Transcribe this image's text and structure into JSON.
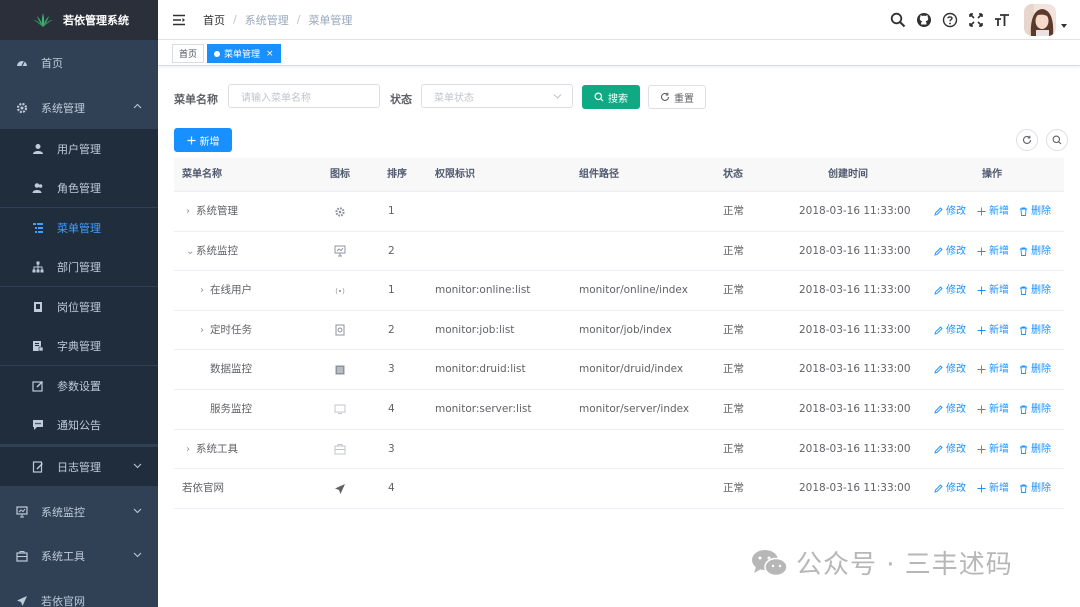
{
  "sidebar": {
    "logo_text": "若依管理系统",
    "items": [
      {
        "label": "首页",
        "icon": "dashboard-icon"
      },
      {
        "label": "系统管理",
        "icon": "gear-icon"
      },
      {
        "label": "用户管理",
        "icon": "user-icon"
      },
      {
        "label": "角色管理",
        "icon": "peoples-icon"
      },
      {
        "label": "菜单管理",
        "icon": "tree-table-icon"
      },
      {
        "label": "部门管理",
        "icon": "tree-icon"
      },
      {
        "label": "岗位管理",
        "icon": "post-icon"
      },
      {
        "label": "字典管理",
        "icon": "dict-icon"
      },
      {
        "label": "参数设置",
        "icon": "edit-icon"
      },
      {
        "label": "通知公告",
        "icon": "message-icon"
      },
      {
        "label": "日志管理",
        "icon": "log-icon"
      },
      {
        "label": "系统监控",
        "icon": "monitor-icon"
      },
      {
        "label": "系统工具",
        "icon": "tool-icon"
      },
      {
        "label": "若依官网",
        "icon": "guide-icon"
      }
    ]
  },
  "navbar": {
    "breadcrumb": [
      "首页",
      "系统管理",
      "菜单管理"
    ],
    "separator": "/"
  },
  "tags": {
    "home": "首页",
    "active": "菜单管理",
    "close": "×"
  },
  "search": {
    "name_label": "菜单名称",
    "name_placeholder": "请输入菜单名称",
    "status_label": "状态",
    "status_placeholder": "菜单状态",
    "search_button": "搜索",
    "reset_button": "重置"
  },
  "toolbar": {
    "add_button": "新增"
  },
  "table": {
    "headers": [
      "菜单名称",
      "图标",
      "排序",
      "权限标识",
      "组件路径",
      "状态",
      "创建时间",
      "操作"
    ],
    "rows": [
      {
        "name": "系统管理",
        "indent": 0,
        "expander": "›",
        "icon": "gear-icon",
        "order": "1",
        "perms": "",
        "component": "",
        "status": "正常",
        "created": "2018-03-16 11:33:00"
      },
      {
        "name": "系统监控",
        "indent": 0,
        "expander": "⌄",
        "icon": "monitor-icon",
        "order": "2",
        "perms": "",
        "component": "",
        "status": "正常",
        "created": "2018-03-16 11:33:00"
      },
      {
        "name": "在线用户",
        "indent": 1,
        "expander": "›",
        "icon": "online-icon",
        "order": "1",
        "perms": "monitor:online:list",
        "component": "monitor/online/index",
        "status": "正常",
        "created": "2018-03-16 11:33:00"
      },
      {
        "name": "定时任务",
        "indent": 1,
        "expander": "›",
        "icon": "job-icon",
        "order": "2",
        "perms": "monitor:job:list",
        "component": "monitor/job/index",
        "status": "正常",
        "created": "2018-03-16 11:33:00"
      },
      {
        "name": "数据监控",
        "indent": 1,
        "expander": "",
        "icon": "druid-icon",
        "order": "3",
        "perms": "monitor:druid:list",
        "component": "monitor/druid/index",
        "status": "正常",
        "created": "2018-03-16 11:33:00"
      },
      {
        "name": "服务监控",
        "indent": 1,
        "expander": "",
        "icon": "server-icon",
        "order": "4",
        "perms": "monitor:server:list",
        "component": "monitor/server/index",
        "status": "正常",
        "created": "2018-03-16 11:33:00"
      },
      {
        "name": "系统工具",
        "indent": 0,
        "expander": "›",
        "icon": "tool-icon",
        "order": "3",
        "perms": "",
        "component": "",
        "status": "正常",
        "created": "2018-03-16 11:33:00"
      },
      {
        "name": "若依官网",
        "indent": 0,
        "expander": "",
        "icon": "guide-icon",
        "order": "4",
        "perms": "",
        "component": "",
        "status": "正常",
        "created": "2018-03-16 11:33:00"
      }
    ],
    "ops": {
      "edit": "修改",
      "add": "新增",
      "delete": "删除"
    }
  },
  "watermark": {
    "text": "公众号 · 三丰述码"
  },
  "colors": {
    "sidebar_bg": "#304156",
    "active_blue": "#1890ff",
    "search_green": "#11a983"
  }
}
